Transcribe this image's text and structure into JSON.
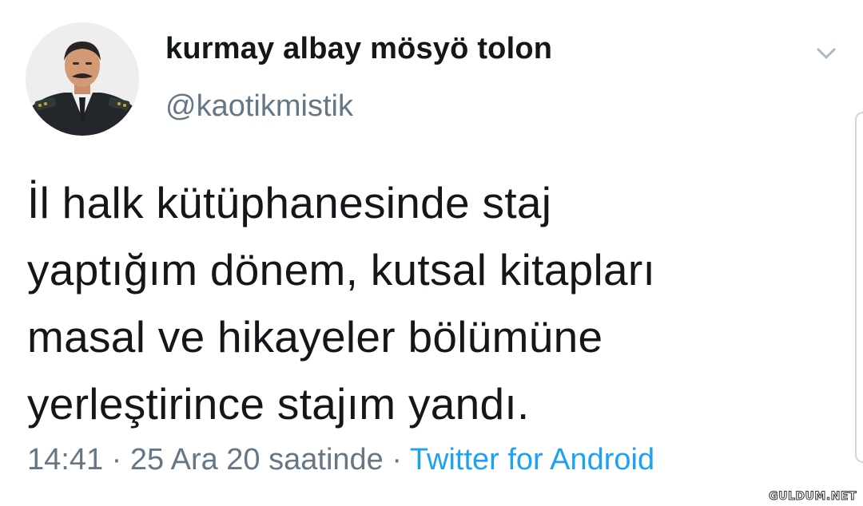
{
  "user": {
    "display_name": "kurmay albay mösyö tolon",
    "handle": "@kaotikmistik"
  },
  "tweet": {
    "lines": [
      "İl halk kütüphanesinde staj",
      "yaptığım dönem, kutsal kitapları",
      "masal ve hikayeler bölümüne",
      "yerleştirince stajım yandı."
    ]
  },
  "meta": {
    "time": "14:41",
    "separator": "·",
    "date": "25 Ara 20 saatinde",
    "source": "Twitter for Android"
  },
  "watermark": "GULDUM.NET",
  "icons": {
    "menu": "chevron-down-icon"
  },
  "colors": {
    "text_primary": "#14171a",
    "text_secondary": "#657786",
    "link": "#1da1f2"
  }
}
